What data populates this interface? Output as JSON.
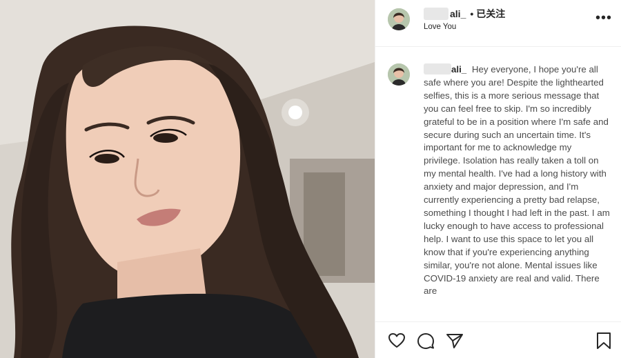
{
  "post": {
    "username_visible": "ali_",
    "follow_separator": "•",
    "follow_state": "已关注",
    "location": "Love You",
    "more_label": "•••"
  },
  "caption": {
    "username_visible": "ali_",
    "text": "Hey everyone, I hope you're all safe where you are! Despite the lighthearted selfies, this is a more serious message that you can feel free to skip. I'm so incredibly grateful to be in a position where I'm safe and secure during such an uncertain time. It's important for me to acknowledge my privilege. Isolation has really taken a toll on my mental health. I've had a long history with anxiety and major depression, and I'm currently experiencing a pretty bad relapse, something I thought I had left in the past. I am lucky enough to have access to professional help. I want to use this space to let you all know that if you're experiencing anything similar, you're not alone. Mental issues like COVID-19 anxiety are real and valid. There are"
  },
  "actions": {
    "icons": [
      "heart-icon",
      "comment-icon",
      "share-icon",
      "bookmark-icon"
    ]
  },
  "colors": {
    "text_primary": "#262626",
    "text_secondary": "#4a4a4a",
    "divider": "#efefef"
  }
}
